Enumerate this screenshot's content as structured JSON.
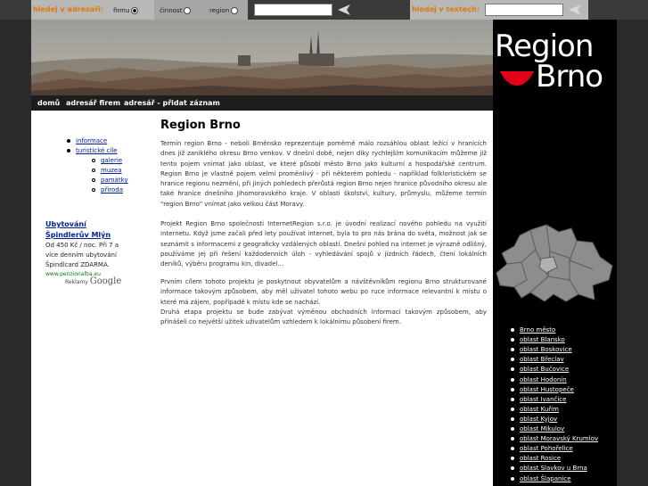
{
  "search_bar": {
    "address_label": "hledej v adresáři:",
    "radio_firmu": "firmu",
    "radio_cinnost": "činnost",
    "radio_region": "region",
    "text_label": "hledej v textech:"
  },
  "logo": {
    "line1": "Region",
    "line2": "Brno"
  },
  "nav": {
    "items": [
      "domů",
      "adresář firem",
      "adresář - přidat záznam"
    ]
  },
  "left_menu": {
    "items": [
      "informace",
      "turistické cíle"
    ],
    "sub_items": [
      "galerie",
      "muzea",
      "památky",
      "příroda"
    ]
  },
  "ad": {
    "title_line1": "Ubytování",
    "title_line2": "Špindlerův Mlýn",
    "body": [
      "Od 450 Kč / noc. Při 7 a",
      "více denním ubytování",
      "Špindlcard ZDARMA."
    ],
    "url": "www.penzionalba.eu",
    "ads_by": "Reklamy",
    "google": "Google"
  },
  "main": {
    "title": "Region Brno",
    "paragraphs": [
      "Termín region Brno - neboli Brněnsko reprezentuje poměrně málo rozsáhlou oblast ležící v hranicích dnes již zaniklého okresu Brno venkov. V dnešní době, nejen díky rychlejším komunikacím můžeme již tento pojem vnímat jako oblast, ve které působí město Brno jako kulturní a hospodářské centrum. Region Brno je vlastně pojem velmi proměnlivý - při některém pohledu - například folkloristickém se hranice regionu nezmění, při jiných pohledech přerůstá region Brno nejen hranice původního okresu ale také hranice dnešního Jihomoravského kraje. V oblasti školství, kultury, průmyslu, můžeme termín \"region Brno\" vnímat jako velkou část Moravy.",
      "Projekt Region Brno společnosti InternetRegion s.r.o. je úvodní realizací nového pohledu na využití internetu. Když jsme začali před lety používat internet, byla to pro nás brána do světa, možnost jak se seznámit s informacemi z geograficky vzdálených oblastí. Dnešní pohled na internet je výrazně odlišný, používáme jej při řešení každodenních úloh - vyhledávání spojů v jízdních řádech, čtení lokálních deníků, výběru programu kin, divadel...",
      "Prvním cílem tohoto projektu je poskytnout obyvatelům a návštěvníkům regionu Brno strukturované informace takovým způsobem, aby měl uživatel tohoto webu po ruce informace relevantní k místu o které má zájem, popřípadě k místu kde se nachází.",
      "Druhá etapa projektu se bude zabývat výměnou obchodních informací takovým způsobem, aby přinášeli co největší užitek uživatelům vzhledem k lokálnímu působení firem."
    ]
  },
  "regions": [
    "Brno město",
    "oblast Blansko",
    "oblast Boskovice",
    "oblast Břeclav",
    "oblast Bučovice",
    "oblast Hodonín",
    "oblast Hustopeče",
    "oblast Ivančice",
    "oblast Kuřim",
    "oblast Kyjov",
    "oblast Mikulov",
    "oblast Moravský Krumlov",
    "oblast Pohořelice",
    "oblast Rosice",
    "oblast Slavkov u Brna",
    "oblast Šlapanice"
  ],
  "colors": {
    "accent": "#e07a00",
    "link": "#00229a",
    "logo_red": "#e3001b"
  }
}
